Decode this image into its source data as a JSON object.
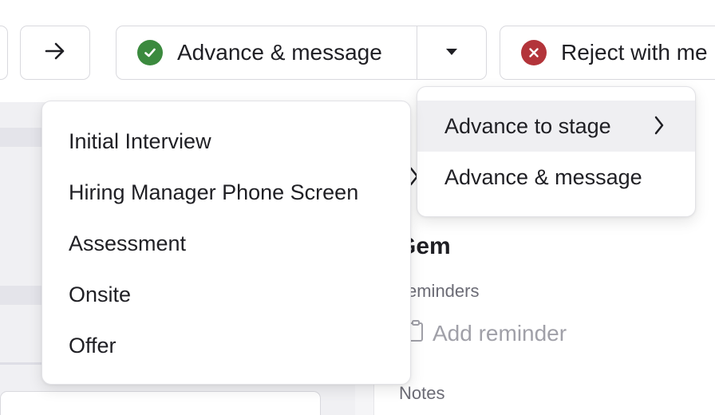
{
  "toolbar": {
    "next_icon": "arrow-right-icon",
    "advance_label": "Advance & message",
    "advance_icon": "check-circle-icon",
    "advance_icon_color": "#3b8a3e",
    "dropdown_icon": "caret-down-icon",
    "reject_label": "Reject with me",
    "reject_icon": "x-circle-icon",
    "reject_icon_color": "#b3343a"
  },
  "action_menu": {
    "items": [
      {
        "label": "Advance to stage",
        "has_submenu": true,
        "active": true
      },
      {
        "label": "Advance & message",
        "has_submenu": false,
        "active": false
      }
    ]
  },
  "stage_menu": {
    "items": [
      {
        "label": "Initial Interview"
      },
      {
        "label": "Hiring Manager Phone Screen"
      },
      {
        "label": "Assessment"
      },
      {
        "label": "Onsite"
      },
      {
        "label": "Offer"
      }
    ]
  },
  "detail_panel": {
    "title": "Gem",
    "reminders_label": "eminders",
    "add_reminder_label": "Add reminder",
    "notes_label": "Notes"
  }
}
